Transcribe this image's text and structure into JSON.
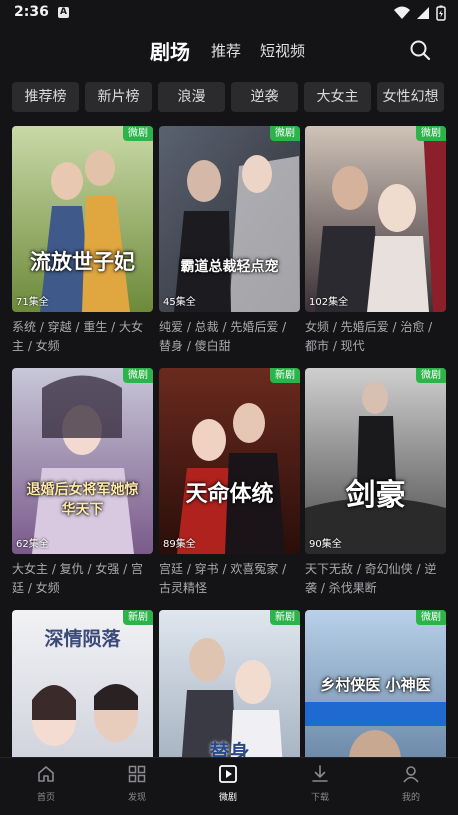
{
  "status_bar": {
    "time": "2:36",
    "notification_letter": "A"
  },
  "header": {
    "tabs": [
      {
        "label": "剧场",
        "active": true
      },
      {
        "label": "推荐",
        "active": false
      },
      {
        "label": "短视频",
        "active": false
      }
    ]
  },
  "categories": [
    "推荐榜",
    "新片榜",
    "浪漫",
    "逆袭",
    "大女主",
    "女性幻想"
  ],
  "dramas": [
    {
      "title_art": "流放世子妃",
      "badge": "微剧",
      "episodes": "71集全",
      "tags": "系统 / 穿越 / 重生 / 大女主 / 女频"
    },
    {
      "title_art": "霸道总裁轻点宠",
      "badge": "微剧",
      "episodes": "45集全",
      "tags": "纯爱 / 总裁 / 先婚后爱 / 替身 / 傻白甜"
    },
    {
      "title_art": "",
      "badge": "微剧",
      "episodes": "102集全",
      "tags": "女频 / 先婚后爱 / 治愈 / 都市 / 现代"
    },
    {
      "title_art": "退婚后女将军她惊华天下",
      "badge": "微剧",
      "episodes": "62集全",
      "tags": "大女主 / 复仇 / 女强 / 宫廷 / 女频"
    },
    {
      "title_art": "天命体统",
      "badge": "新剧",
      "episodes": "89集全",
      "tags": "宫廷 / 穿书 / 欢喜冤家 / 古灵精怪"
    },
    {
      "title_art": "剑豪",
      "badge": "微剧",
      "episodes": "90集全",
      "tags": "天下无敌 / 奇幻仙侠 / 逆袭 / 杀伐果断"
    },
    {
      "title_art": "深情陨落",
      "badge": "新剧",
      "episodes": "",
      "tags": ""
    },
    {
      "title_art": "替身",
      "badge": "新剧",
      "episodes": "",
      "tags": ""
    },
    {
      "title_art": "乡村侠医 小神医",
      "badge": "微剧",
      "episodes": "",
      "tags": ""
    }
  ],
  "bottom_nav": [
    {
      "label": "首页",
      "icon": "home-icon",
      "active": false
    },
    {
      "label": "发现",
      "icon": "grid-icon",
      "active": false
    },
    {
      "label": "微剧",
      "icon": "play-icon",
      "active": true
    },
    {
      "label": "下载",
      "icon": "download-icon",
      "active": false
    },
    {
      "label": "我的",
      "icon": "person-icon",
      "active": false
    }
  ],
  "colors": {
    "background": "#141416",
    "badge_green": "#2cb34a",
    "chip_bg": "#2b2b2e"
  }
}
